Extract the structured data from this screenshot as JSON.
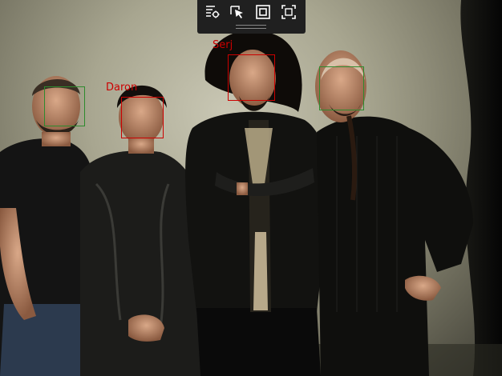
{
  "toolbar": {
    "tools": [
      {
        "icon": "list-settings-icon",
        "action": "settings"
      },
      {
        "icon": "select-cursor-icon",
        "action": "select"
      },
      {
        "icon": "frame-square-icon",
        "action": "box"
      },
      {
        "icon": "fit-screen-icon",
        "action": "fit"
      }
    ],
    "drag_handle_icon": "drag-handle-icon"
  },
  "faces": [
    {
      "label": "Serj",
      "color": "#cc0000"
    },
    {
      "label": "Daron",
      "color": "#cc0000"
    },
    {
      "label": "",
      "color": "#2e8b2e"
    },
    {
      "label": "",
      "color": "#2e8b2e"
    }
  ],
  "colors": {
    "toolbar_bg": "#202020",
    "toolbar_icon": "#ffffff",
    "named_face_box": "#cc0000",
    "unnamed_face_box": "#2e8b2e"
  }
}
